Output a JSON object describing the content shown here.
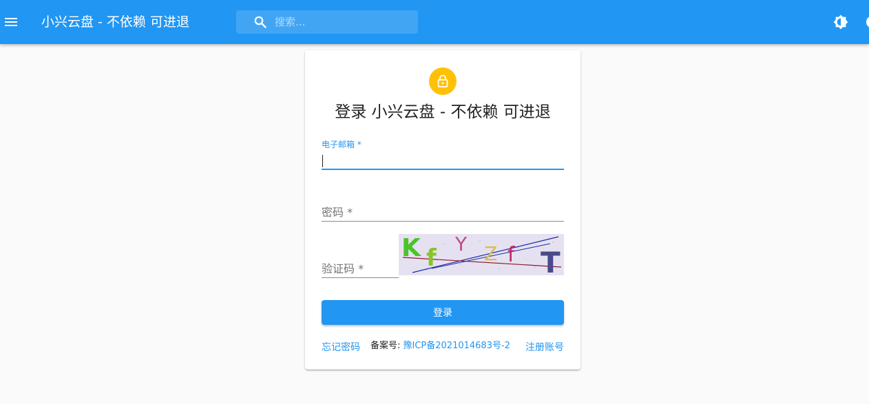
{
  "appbar": {
    "title": "小兴云盘 - 不依赖 可进退",
    "search_placeholder": "搜索...",
    "color": "#2196f3"
  },
  "login": {
    "title": "登录 小兴云盘 - 不依赖 可进退",
    "email_label": "电子邮箱 *",
    "email_value": "",
    "password_label": "密码 *",
    "captcha_label": "验证码 *",
    "captcha_text": "KfYZfT",
    "submit_label": "登录",
    "forgot_label": "忘记密码",
    "register_label": "注册账号",
    "icp_prefix": "备案号: ",
    "icp_number": "豫ICP备2021014683号-2",
    "avatar_color": "#ffc107"
  }
}
